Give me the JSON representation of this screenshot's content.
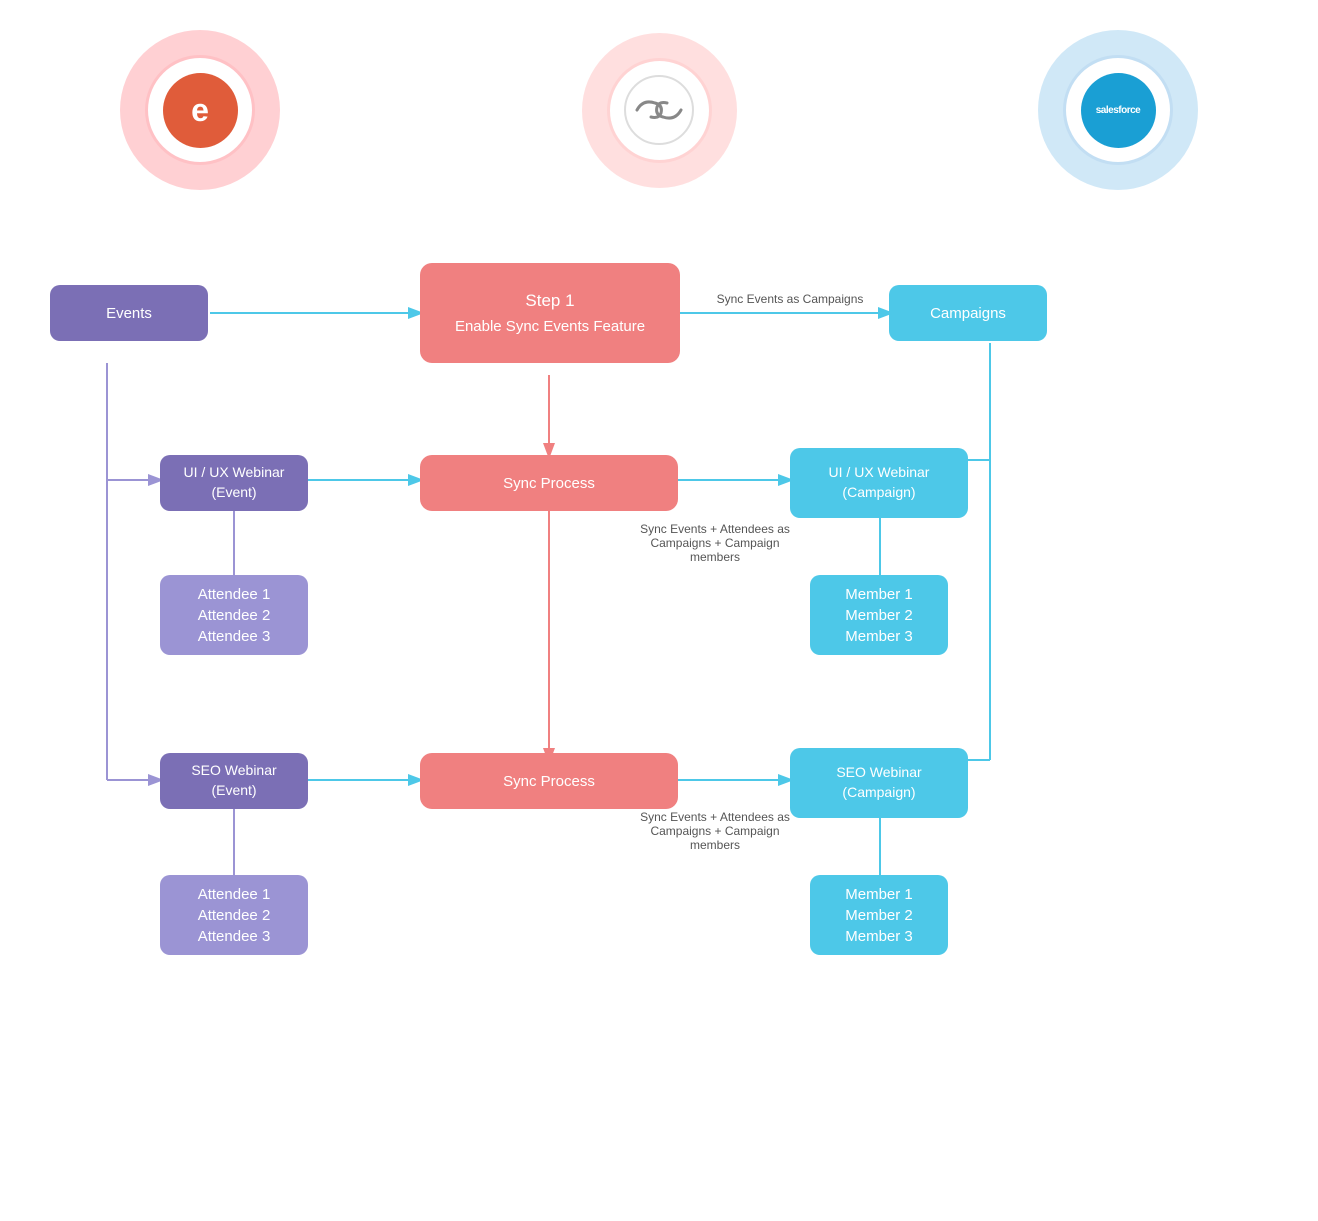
{
  "logos": {
    "eventbrite": {
      "letter": "e",
      "alt": "Eventbrite"
    },
    "syncapps": {
      "text": "SyncApps",
      "alt": "SyncApps"
    },
    "salesforce": {
      "text": "salesforce",
      "alt": "Salesforce"
    }
  },
  "diagram": {
    "step1": {
      "line1": "Step 1",
      "line2": "Enable Sync Events Feature"
    },
    "sync_process_1": {
      "label": "Sync Process"
    },
    "sync_process_2": {
      "label": "Sync Process"
    },
    "events": {
      "label": "Events"
    },
    "campaigns": {
      "label": "Campaigns"
    },
    "ui_ux_event": {
      "label": "UI / UX Webinar (Event)"
    },
    "seo_event": {
      "label": "SEO Webinar (Event)"
    },
    "attendees_1": {
      "label": "Attendee 1\nAttendee 2\nAttendee 3"
    },
    "attendees_2": {
      "label": "Attendee 1\nAttendee 2\nAttendee 3"
    },
    "ui_ux_campaign": {
      "label": "UI / UX Webinar\n(Campaign)"
    },
    "seo_campaign": {
      "label": "SEO Webinar\n(Campaign)"
    },
    "members_1": {
      "label": "Member 1\nMember 2\nMember 3"
    },
    "members_2": {
      "label": "Member 1\nMember 2\nMember 3"
    },
    "arrow_sync_events": {
      "text": "Sync Events as Campaigns"
    },
    "arrow_sync_attendees_1": {
      "text": "Sync Events + Attendees\nas Campaigns +\nCampaign members"
    },
    "arrow_sync_attendees_2": {
      "text": "Sync Events + Attendees\nas Campaigns + Campaign\nmembers"
    }
  }
}
